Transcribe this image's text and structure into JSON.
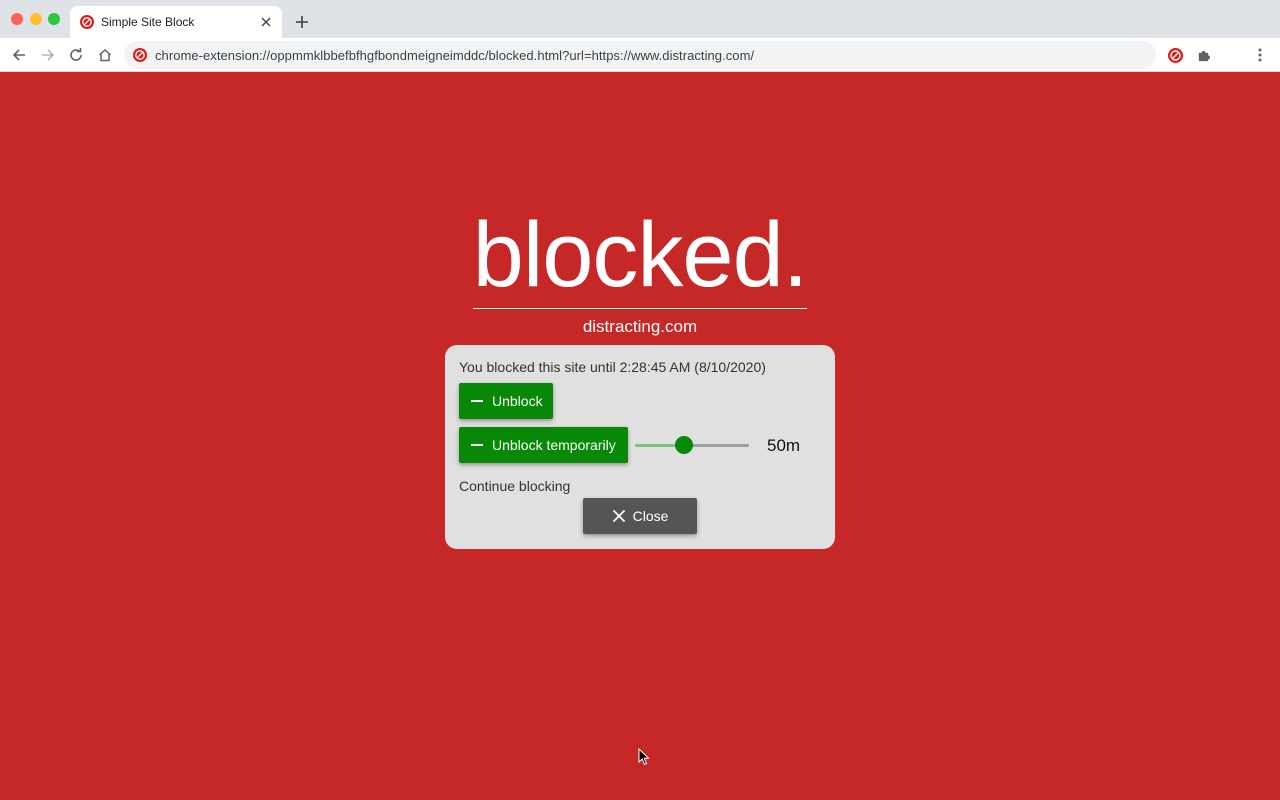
{
  "browser": {
    "tab": {
      "title": "Simple Site Block",
      "favicon": "block-icon"
    },
    "address_bar": {
      "url": "chrome-extension://oppmmklbbefbfhgfbondmeigneimddc/blocked.html?url=https://www.distracting.com/"
    },
    "toolbar_icons": [
      "back-icon",
      "forward-icon",
      "reload-icon",
      "home-icon",
      "extension-block-icon",
      "puzzle-icon",
      "menu-icon"
    ]
  },
  "page": {
    "headline": "blocked.",
    "site": "distracting.com",
    "background_color": "#c62828"
  },
  "panel": {
    "blocked_until": "You blocked this site until 2:28:45 AM (8/10/2020)",
    "unblock_label": "Unblock",
    "unblock_temp_label": "Unblock temporarily",
    "slider_value": "50m",
    "slider_fraction": 0.43,
    "continue_label": "Continue blocking",
    "close_label": "Close",
    "accent_color": "#078807"
  }
}
